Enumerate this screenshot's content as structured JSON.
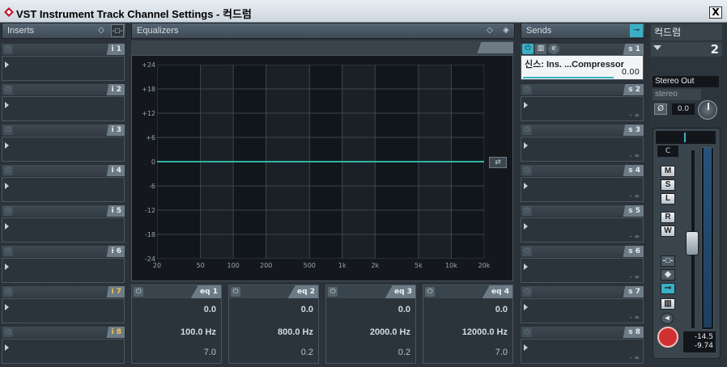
{
  "window": {
    "title": "VST Instrument Track Channel Settings - 컥드럼",
    "close_label": "X"
  },
  "inserts": {
    "header": "Inserts",
    "slots": [
      {
        "label": "i 1",
        "highlight": false
      },
      {
        "label": "i 2",
        "highlight": false
      },
      {
        "label": "i 3",
        "highlight": false
      },
      {
        "label": "i 4",
        "highlight": false
      },
      {
        "label": "i 5",
        "highlight": false
      },
      {
        "label": "i 6",
        "highlight": false
      },
      {
        "label": "i 7",
        "highlight": true
      },
      {
        "label": "i 8",
        "highlight": true
      }
    ]
  },
  "equalizers": {
    "header": "Equalizers",
    "y_labels": [
      "+24",
      "+18",
      "+12",
      "+6",
      "0",
      "-6",
      "-12",
      "-18",
      "-24"
    ],
    "x_labels": [
      "20",
      "50",
      "100",
      "200",
      "500",
      "1k",
      "2k",
      "5k",
      "10k",
      "20k"
    ],
    "bands": [
      {
        "label": "eq 1",
        "gain": "0.0",
        "freq": "100.0 Hz",
        "q": "7.0"
      },
      {
        "label": "eq 2",
        "gain": "0.0",
        "freq": "800.0 Hz",
        "q": "0.2"
      },
      {
        "label": "eq 3",
        "gain": "0.0",
        "freq": "2000.0 Hz",
        "q": "0.2"
      },
      {
        "label": "eq 4",
        "gain": "0.0",
        "freq": "12000.0 Hz",
        "q": "7.0"
      }
    ]
  },
  "sends": {
    "header": "Sends",
    "send1": {
      "label": "s 1",
      "name": "신스: Ins. ...Compressor",
      "value": "0.00"
    },
    "slots": [
      {
        "label": "s 2",
        "db": "- ∞"
      },
      {
        "label": "s 3",
        "db": "- ∞"
      },
      {
        "label": "s 4",
        "db": "- ∞"
      },
      {
        "label": "s 5",
        "db": "- ∞"
      },
      {
        "label": "s 6",
        "db": "- ∞"
      },
      {
        "label": "s 7",
        "db": "- ∞"
      },
      {
        "label": "s 8",
        "db": "- ∞"
      }
    ]
  },
  "channel": {
    "name": "컥드럼",
    "number": "2",
    "output": "Stereo Out",
    "config": "stereo",
    "phase_label": "Ø",
    "gain": "0.0",
    "pan": "C",
    "buttons": {
      "mute": "M",
      "solo": "S",
      "listen": "L",
      "read": "R",
      "write": "W"
    },
    "level_peak": "-14.5",
    "level_value": "-9.74"
  },
  "colors": {
    "accent": "#3ab0c6",
    "record": "#d03030",
    "eq_curve": "#2fb5a6"
  }
}
